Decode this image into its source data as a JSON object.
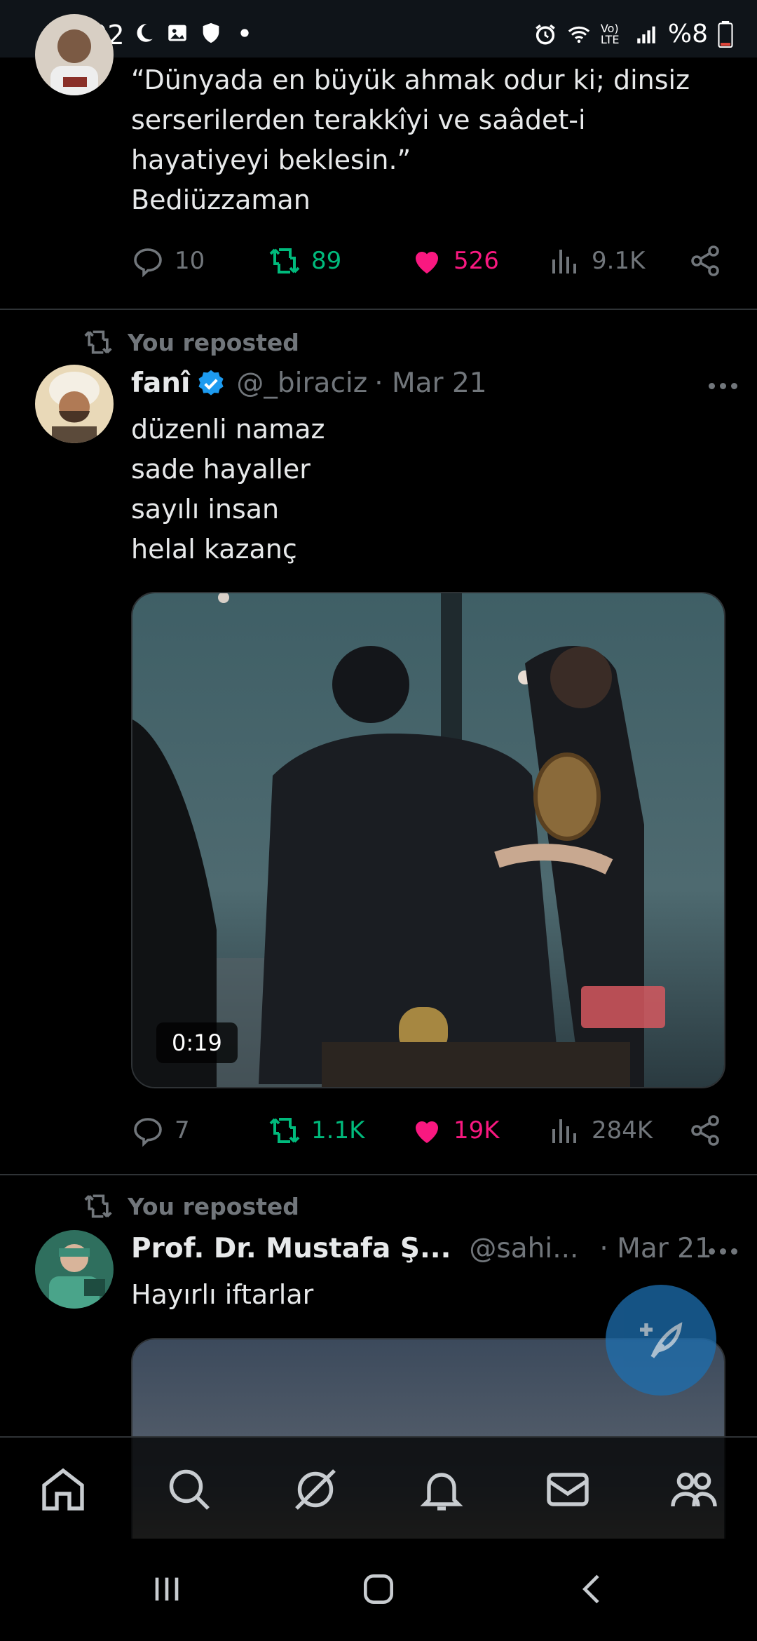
{
  "status_bar": {
    "time": "14:02",
    "battery": "%8",
    "network_label": "Vo) LTE"
  },
  "posts": [
    {
      "text_lines": [
        "“Dünyada en büyük ahmak odur ki; dinsiz",
        "serserilerden terakkîyi ve saâdet-i",
        "hayatiyeyi beklesin.”",
        "Bediüzzaman"
      ],
      "actions": {
        "replies": "10",
        "reposts": "89",
        "likes": "526",
        "views": "9.1K"
      }
    },
    {
      "repost_label": "You reposted",
      "author": {
        "name": "fanî",
        "handle": "@_biraciz",
        "date": "· Mar 21",
        "verified": true
      },
      "text_lines": [
        "düzenli namaz",
        "sade hayaller",
        "sayılı insan",
        "helal kazanç"
      ],
      "video": {
        "duration": "0:19"
      },
      "actions": {
        "replies": "7",
        "reposts": "1.1K",
        "likes": "19K",
        "views": "284K"
      }
    },
    {
      "repost_label": "You reposted",
      "author": {
        "name": "Prof. Dr. Mustafa Ş...",
        "handle": "@sahi...",
        "date": "· Mar 21"
      },
      "text_lines": [
        "Hayırlı iftarlar"
      ]
    }
  ],
  "bottom_nav": [
    "home-icon",
    "search-icon",
    "grok-icon",
    "notifications-icon",
    "messages-icon",
    "communities-icon"
  ],
  "colors": {
    "accent": "#1d9bf0",
    "repost_green": "#00ba7c",
    "like_pink": "#f91880",
    "muted": "#71767b",
    "divider": "#2f3336"
  }
}
